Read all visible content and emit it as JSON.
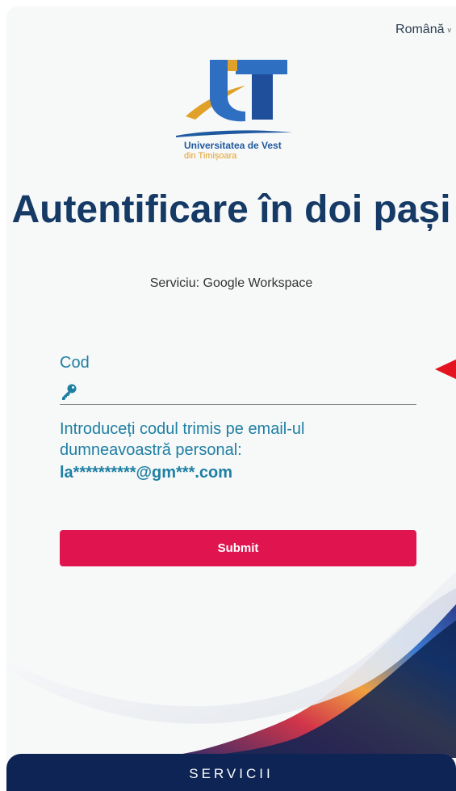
{
  "language_selector": {
    "label": "Română"
  },
  "logo": {
    "name_line1": "Universitatea de Vest",
    "name_line2": "din Timișoara"
  },
  "title": "Autentificare în doi pași",
  "subtitle": "Serviciu: Google Workspace",
  "code_field": {
    "label": "Cod",
    "value": "",
    "placeholder": ""
  },
  "instructions": "Introduceți codul trimis pe email-ul dumneavoastră personal:",
  "masked_email": "la**********@gm***.com",
  "submit_label": "Submit",
  "footer": {
    "servicii_label": "SERVICII"
  },
  "colors": {
    "brand_navy": "#163a66",
    "teal_text": "#1e7fa3",
    "submit_red": "#e01550",
    "footer_navy": "#0d2454",
    "annotation_arrow": "#e3141f"
  }
}
